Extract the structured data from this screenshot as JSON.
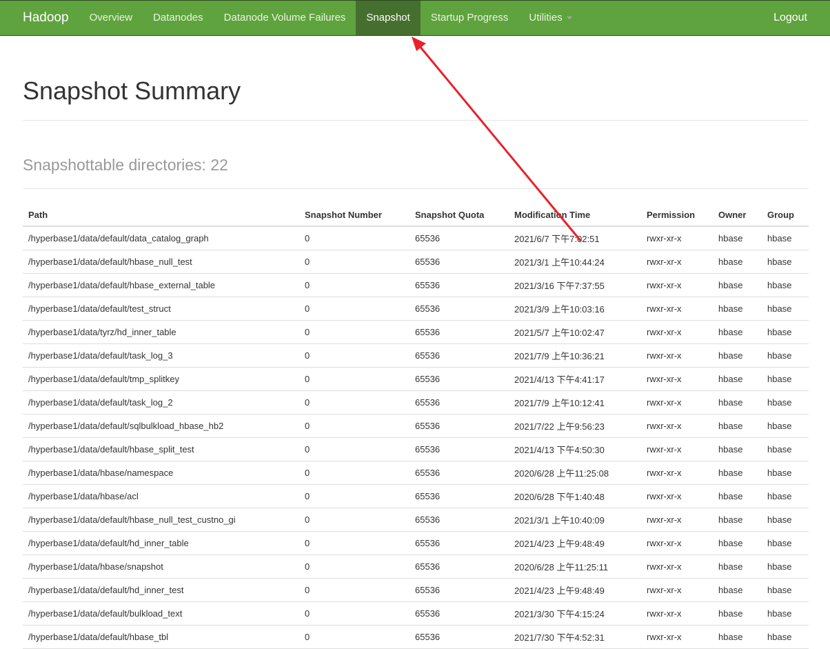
{
  "navbar": {
    "brand": "Hadoop",
    "items": [
      {
        "label": "Overview",
        "active": false
      },
      {
        "label": "Datanodes",
        "active": false
      },
      {
        "label": "Datanode Volume Failures",
        "active": false
      },
      {
        "label": "Snapshot",
        "active": true
      },
      {
        "label": "Startup Progress",
        "active": false
      },
      {
        "label": "Utilities",
        "active": false,
        "dropdown": true
      }
    ],
    "logout": "Logout",
    "colors": {
      "background": "#5fa33e",
      "active": "#456f2e"
    }
  },
  "page": {
    "title": "Snapshot Summary",
    "subtitle": "Snapshottable directories: 22"
  },
  "table": {
    "columns": [
      "Path",
      "Snapshot Number",
      "Snapshot Quota",
      "Modification Time",
      "Permission",
      "Owner",
      "Group"
    ],
    "rows": [
      [
        "/hyperbase1/data/default/data_catalog_graph",
        "0",
        "65536",
        "2021/6/7 下午7:02:51",
        "rwxr-xr-x",
        "hbase",
        "hbase"
      ],
      [
        "/hyperbase1/data/default/hbase_null_test",
        "0",
        "65536",
        "2021/3/1 上午10:44:24",
        "rwxr-xr-x",
        "hbase",
        "hbase"
      ],
      [
        "/hyperbase1/data/default/hbase_external_table",
        "0",
        "65536",
        "2021/3/16 下午7:37:55",
        "rwxr-xr-x",
        "hbase",
        "hbase"
      ],
      [
        "/hyperbase1/data/default/test_struct",
        "0",
        "65536",
        "2021/3/9 上午10:03:16",
        "rwxr-xr-x",
        "hbase",
        "hbase"
      ],
      [
        "/hyperbase1/data/tyrz/hd_inner_table",
        "0",
        "65536",
        "2021/5/7 上午10:02:47",
        "rwxr-xr-x",
        "hbase",
        "hbase"
      ],
      [
        "/hyperbase1/data/default/task_log_3",
        "0",
        "65536",
        "2021/7/9 上午10:36:21",
        "rwxr-xr-x",
        "hbase",
        "hbase"
      ],
      [
        "/hyperbase1/data/default/tmp_splitkey",
        "0",
        "65536",
        "2021/4/13 下午4:41:17",
        "rwxr-xr-x",
        "hbase",
        "hbase"
      ],
      [
        "/hyperbase1/data/default/task_log_2",
        "0",
        "65536",
        "2021/7/9 上午10:12:41",
        "rwxr-xr-x",
        "hbase",
        "hbase"
      ],
      [
        "/hyperbase1/data/default/sqlbulkload_hbase_hb2",
        "0",
        "65536",
        "2021/7/22 上午9:56:23",
        "rwxr-xr-x",
        "hbase",
        "hbase"
      ],
      [
        "/hyperbase1/data/default/hbase_split_test",
        "0",
        "65536",
        "2021/4/13 下午4:50:30",
        "rwxr-xr-x",
        "hbase",
        "hbase"
      ],
      [
        "/hyperbase1/data/hbase/namespace",
        "0",
        "65536",
        "2020/6/28 上午11:25:08",
        "rwxr-xr-x",
        "hbase",
        "hbase"
      ],
      [
        "/hyperbase1/data/hbase/acl",
        "0",
        "65536",
        "2020/6/28 下午1:40:48",
        "rwxr-xr-x",
        "hbase",
        "hbase"
      ],
      [
        "/hyperbase1/data/default/hbase_null_test_custno_gi",
        "0",
        "65536",
        "2021/3/1 上午10:40:09",
        "rwxr-xr-x",
        "hbase",
        "hbase"
      ],
      [
        "/hyperbase1/data/default/hd_inner_table",
        "0",
        "65536",
        "2021/4/23 上午9:48:49",
        "rwxr-xr-x",
        "hbase",
        "hbase"
      ],
      [
        "/hyperbase1/data/hbase/snapshot",
        "0",
        "65536",
        "2020/6/28 上午11:25:11",
        "rwxr-xr-x",
        "hbase",
        "hbase"
      ],
      [
        "/hyperbase1/data/default/hd_inner_test",
        "0",
        "65536",
        "2021/4/23 上午9:48:49",
        "rwxr-xr-x",
        "hbase",
        "hbase"
      ],
      [
        "/hyperbase1/data/default/bulkload_text",
        "0",
        "65536",
        "2021/3/30 下午4:15:24",
        "rwxr-xr-x",
        "hbase",
        "hbase"
      ],
      [
        "/hyperbase1/data/default/hbase_tbl",
        "0",
        "65536",
        "2021/7/30 下午4:52:31",
        "rwxr-xr-x",
        "hbase",
        "hbase"
      ]
    ]
  },
  "annotation": {
    "type": "arrow",
    "color": "#e8212b",
    "points_to": "Snapshot nav tab"
  }
}
